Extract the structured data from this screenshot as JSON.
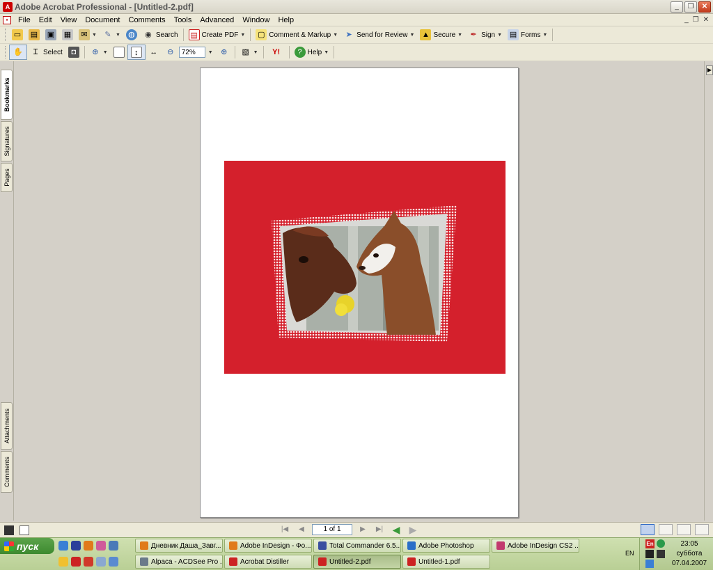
{
  "window": {
    "title": "Adobe Acrobat Professional - [Untitled-2.pdf]",
    "controls": [
      "_",
      "❐",
      "✕"
    ],
    "mdi_controls": [
      "_",
      "❐",
      "✕"
    ]
  },
  "menu": [
    "File",
    "Edit",
    "View",
    "Document",
    "Comments",
    "Tools",
    "Advanced",
    "Window",
    "Help"
  ],
  "toolbar1": {
    "search": "Search",
    "create_pdf": "Create PDF",
    "comment_markup": "Comment & Markup",
    "send_for_review": "Send for Review",
    "secure": "Secure",
    "sign": "Sign",
    "forms": "Forms"
  },
  "toolbar2": {
    "select": "Select",
    "zoom_value": "72%",
    "help": "Help",
    "yahoo_logo": "Y!"
  },
  "left_tabs": [
    "Bookmarks",
    "Signatures",
    "Pages",
    "Attachments",
    "Comments"
  ],
  "navigation": {
    "page_indicator": "1 of 1"
  },
  "taskbar": {
    "start_label": "пуск",
    "row1": [
      {
        "label": "Дневник Даша_Завг...",
        "color": "#e07a1a"
      },
      {
        "label": "Adobe InDesign - Фо...",
        "color": "#e07a1a"
      },
      {
        "label": "Total Commander 6.5...",
        "color": "#3a4fa0"
      },
      {
        "label": "Adobe Photoshop",
        "color": "#2a6ec8"
      },
      {
        "label": "Adobe InDesign CS2 ...",
        "color": "#c23a6e"
      }
    ],
    "row2": [
      {
        "label": "Alpaca - ACDSee Pro ...",
        "color": "#6a7a8a"
      },
      {
        "label": "Acrobat Distiller",
        "color": "#c22"
      },
      {
        "label": "Untitled-2.pdf",
        "color": "#c22"
      },
      {
        "label": "Untitled-1.pdf",
        "color": "#c22"
      }
    ],
    "tray": {
      "input_lang": "EN",
      "lang_badge": "En",
      "time": "23:05",
      "day": "суббота",
      "date": "07.04.2007"
    }
  },
  "colors": {
    "artboard_red": "#d4202c",
    "taskbar_green": "#b9cf95"
  }
}
